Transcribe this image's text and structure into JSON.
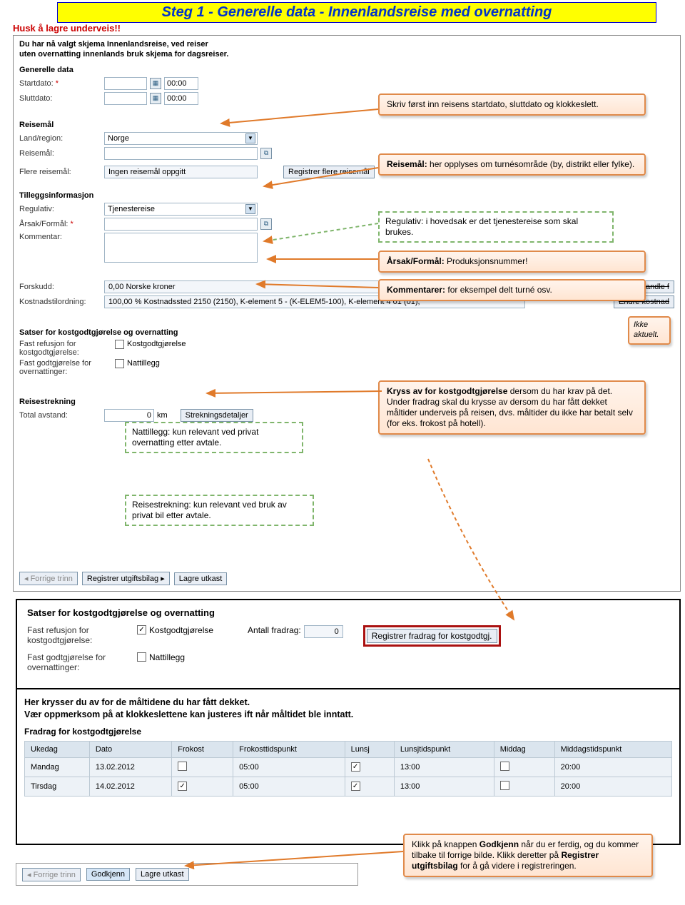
{
  "banner": {
    "title": "Steg 1 - Generelle data - Innenlandsreise med overnatting"
  },
  "red_note": "Husk å lagre underveis!!",
  "intro": {
    "line1": "Du har nå valgt skjema Innenlandsreise, ved reiser",
    "line2": "uten overnatting innenlands bruk skjema for dagsreiser."
  },
  "sections": {
    "generelle": "Generelle data",
    "reisemaal": "Reisemål",
    "tillegg": "Tilleggsinformasjon",
    "satser": "Satser for kostgodtgjørelse og overnatting",
    "reisestrekning": "Reisestrekning"
  },
  "fields": {
    "startdato": "Startdato:",
    "sluttdato": "Sluttdato:",
    "start_time": "00:00",
    "slut_time": "00:00",
    "land": "Land/region:",
    "land_val": "Norge",
    "reisemaal": "Reisemål:",
    "flere": "Flere reisemål:",
    "flere_val": "Ingen reisemål oppgitt",
    "flere_btn": "Registrer flere reisemål",
    "regulativ": "Regulativ:",
    "regulativ_val": "Tjenestereise",
    "aarsak": "Årsak/Formål:",
    "kommentar": "Kommentar:",
    "forskudd": "Forskudd:",
    "forskudd_val": "0,00 Norske kroner",
    "kostnad": "Kostnadstilordning:",
    "kostnad_val": "100,00 % Kostnadssted 2150 (2150), K-element 5 - (K-ELEM5-100), K-element 4 01 (01),",
    "behandle_btn": "Behandle f",
    "endre_btn": "Endre kostnad",
    "fast_kost": "Fast refusjon for kostgodtgjørelse:",
    "kost_chk_lbl": "Kostgodtgjørelse",
    "fast_natt": "Fast godtgjørelse for overnattinger:",
    "natt_chk_lbl": "Nattillegg",
    "total": "Total avstand:",
    "total_val": "0",
    "km": "km",
    "strek_btn": "Strekningsdetaljer"
  },
  "nav": {
    "forrige": "Forrige trinn",
    "registrer": "Registrer utgiftsbilag",
    "lagre": "Lagre utkast",
    "godkjenn": "Godkjenn"
  },
  "callouts": {
    "c1": "Skriv først inn reisens startdato, sluttdato og klokkeslett.",
    "c2_a": "Reisemål:",
    "c2_b": " her opplyses om turnésområde (by, distrikt eller fylke).",
    "c3": "Regulativ: i hovedsak er det tjenestereise som skal brukes.",
    "c4_a": "Årsak/Formål:",
    "c4_b": " Produksjonsnummer!",
    "c5_a": "Kommentarer:",
    "c5_b": " for eksempel delt turné osv.",
    "c6": "Ikke aktuelt.",
    "c7_a": "Kryss av for kostgodtgjørelse",
    "c7_b": " dersom du har krav på det. Under fradrag skal du krysse av dersom du har fått dekket måltider underveis på reisen, dvs. måltider du ikke har betalt selv (for eks. frokost på hotell).",
    "c8": "Nattillegg: kun relevant ved privat overnatting etter avtale.",
    "c9": "Reisestrekning: kun relevant ved bruk av privat bil etter avtale.",
    "c10_a": "Klikk på knappen ",
    "c10_b": "Godkjenn",
    "c10_c": " når du er ferdig, og du kommer tilbake til forrige bilde. Klikk deretter på ",
    "c10_d": "Registrer utgiftsbilag",
    "c10_e": " for å gå videre i registreringen."
  },
  "panel2": {
    "head": "Satser for kostgodtgjørelse og overnatting",
    "fast_kost": "Fast refusjon for kostgodtgjørelse:",
    "kost_chk_lbl": "Kostgodtgjørelse",
    "antall": "Antall fradrag:",
    "antall_val": "0",
    "reg_btn": "Registrer fradrag for kostgodtgj.",
    "fast_natt": "Fast godtgjørelse for overnattinger:",
    "natt_chk_lbl": "Nattillegg"
  },
  "panel3": {
    "line1": "Her krysser du av for de måltidene du har fått dekket.",
    "line2": "Vær oppmerksom på at klokkeslettene kan justeres ift når måltidet ble inntatt.",
    "sub": "Fradrag for kostgodtgjørelse",
    "headers": [
      "Ukedag",
      "Dato",
      "Frokost",
      "Frokosttidspunkt",
      "Lunsj",
      "Lunsjtidspunkt",
      "Middag",
      "Middagstidspunkt"
    ],
    "rows": [
      {
        "day": "Mandag",
        "date": "13.02.2012",
        "f": false,
        "ft": "05:00",
        "l": true,
        "lt": "13:00",
        "m": false,
        "mt": "20:00"
      },
      {
        "day": "Tirsdag",
        "date": "14.02.2012",
        "f": true,
        "ft": "05:00",
        "l": true,
        "lt": "13:00",
        "m": false,
        "mt": "20:00"
      }
    ]
  }
}
